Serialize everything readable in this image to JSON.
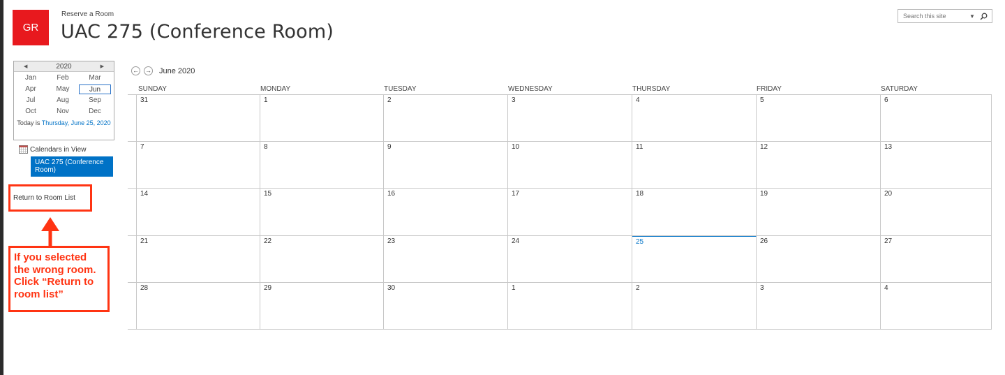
{
  "header": {
    "logo_text": "GR",
    "site_title": "Reserve a Room",
    "page_title": "UAC 275 (Conference Room)",
    "search_placeholder": "Search this site"
  },
  "date_picker": {
    "year": "2020",
    "months": [
      "Jan",
      "Feb",
      "Mar",
      "Apr",
      "May",
      "Jun",
      "Jul",
      "Aug",
      "Sep",
      "Oct",
      "Nov",
      "Dec"
    ],
    "selected_month": "Jun",
    "today_prefix": "Today is ",
    "today_link": "Thursday, June 25, 2020"
  },
  "calendars_in_view": {
    "label": "Calendars in View",
    "items": [
      "UAC 275 (Conference Room)"
    ]
  },
  "return_link": "Return to Room List",
  "annotation": {
    "text": "If you selected\nthe wrong room.\nClick “Return to\nroom list”",
    "color": "#ff3413"
  },
  "calendar": {
    "month_label": "June 2020",
    "day_headers": [
      "SUNDAY",
      "MONDAY",
      "TUESDAY",
      "WEDNESDAY",
      "THURSDAY",
      "FRIDAY",
      "SATURDAY"
    ],
    "weeks": [
      [
        "31",
        "1",
        "2",
        "3",
        "4",
        "5",
        "6"
      ],
      [
        "7",
        "8",
        "9",
        "10",
        "11",
        "12",
        "13"
      ],
      [
        "14",
        "15",
        "16",
        "17",
        "18",
        "19",
        "20"
      ],
      [
        "21",
        "22",
        "23",
        "24",
        "25",
        "26",
        "27"
      ],
      [
        "28",
        "29",
        "30",
        "1",
        "2",
        "3",
        "4"
      ]
    ],
    "today_date": "25"
  },
  "colors": {
    "brand": "#e8191e",
    "accent": "#0072c6",
    "annotation": "#ff3413"
  }
}
